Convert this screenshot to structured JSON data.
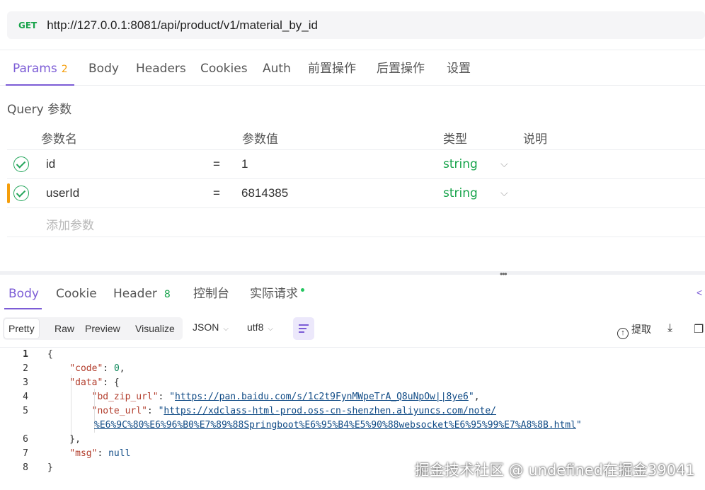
{
  "request": {
    "method": "GET",
    "url": "http://127.0.0.1:8081/api/product/v1/material_by_id"
  },
  "request_tabs": [
    {
      "label": "Params",
      "badge": "2",
      "active": true
    },
    {
      "label": "Body"
    },
    {
      "label": "Headers"
    },
    {
      "label": "Cookies"
    },
    {
      "label": "Auth"
    },
    {
      "label": "前置操作"
    },
    {
      "label": "后置操作"
    },
    {
      "label": "设置"
    }
  ],
  "query": {
    "title": "Query 参数",
    "columns": [
      "参数名",
      "参数值",
      "类型",
      "说明"
    ],
    "rows": [
      {
        "name": "id",
        "eq": "=",
        "value": "1",
        "type": "string",
        "enabled": true
      },
      {
        "name": "userId",
        "eq": "=",
        "value": "6814385",
        "type": "string",
        "enabled": true
      }
    ],
    "add_placeholder": "添加参数"
  },
  "splitter_handle": "•••",
  "response_tabs": [
    {
      "label": "Body",
      "active": true
    },
    {
      "label": "Cookie"
    },
    {
      "label": "Header",
      "badge": "8"
    },
    {
      "label": "控制台"
    },
    {
      "label": "实际请求"
    }
  ],
  "toolbar": {
    "view_modes": [
      "Pretty",
      "Raw",
      "Preview",
      "Visualize"
    ],
    "active_mode": "Pretty",
    "format": "JSON",
    "encoding": "utf8",
    "extract_label": "提取"
  },
  "code": {
    "line_numbers": [
      "1",
      "2",
      "3",
      "4",
      "5",
      "6",
      "7",
      "8"
    ],
    "code_value": "0",
    "bd_zip_url": "https://pan.baidu.com/s/1c2t9FynMWpeTrA_Q8uNpOw||8ye6",
    "note_url_part1": "https://xdclass-html-prod.oss-cn-shenzhen.aliyuncs.com/note/",
    "note_url_part2": "%E6%9C%80%E6%96%B0%E7%89%88Springboot%E6%95%B4%E5%90%88websocket%E6%95%99%E7%A8%8B.html",
    "msg_value": "null"
  },
  "watermark": "掘金技术社区 @ undefined在掘金39041"
}
